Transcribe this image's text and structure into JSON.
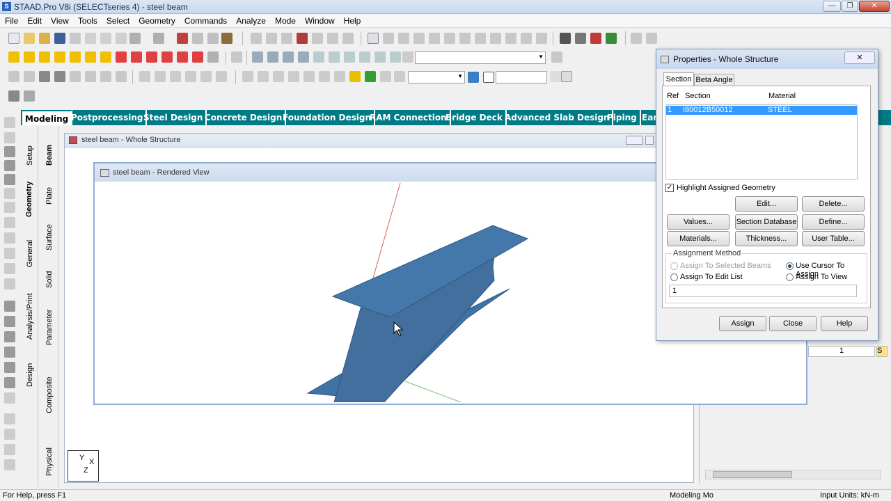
{
  "app": {
    "title": "STAAD.Pro V8i (SELECTseries 4) - steel beam",
    "icon_glyph": "S",
    "win_controls": {
      "minimize": "—",
      "restore": "❐",
      "close": "✕"
    }
  },
  "menu": [
    "File",
    "Edit",
    "View",
    "Tools",
    "Select",
    "Geometry",
    "Commands",
    "Analyze",
    "Mode",
    "Window",
    "Help"
  ],
  "page_tabs": [
    "Modeling",
    "Postprocessing",
    "Steel Design",
    "Concrete Design",
    "Foundation Design",
    "RAM Connection",
    "Bridge Deck",
    "Advanced Slab Design",
    "Piping",
    "Ear"
  ],
  "vertical_tabs_outer": [
    "Setup",
    "Geometry",
    "General",
    "Analysis/Print",
    "Design"
  ],
  "vertical_tabs_inner": [
    "Beam",
    "Plate",
    "Surface",
    "Solid",
    "Parameter",
    "Composite",
    "Physical"
  ],
  "windows": {
    "whole_structure": {
      "title": "steel beam - Whole Structure"
    },
    "rendered_view": {
      "title": "steel beam - Rendered View"
    }
  },
  "axes_triad": {
    "y": "Y",
    "x": "X",
    "z": "Z"
  },
  "properties": {
    "title": "Properties - Whole Structure",
    "tabs": [
      "Section",
      "Beta Angle"
    ],
    "table_headers": {
      "ref": "Ref",
      "section": "Section",
      "material": "Material"
    },
    "rows": [
      {
        "ref": "1",
        "section": "I80012B50012",
        "material": "STEEL"
      }
    ],
    "highlight_label": "Highlight Assigned Geometry",
    "buttons": {
      "edit": "Edit...",
      "delete": "Delete...",
      "values": "Values...",
      "section_db": "Section Database",
      "define": "Define...",
      "materials": "Materials...",
      "thickness": "Thickness...",
      "user_table": "User Table...",
      "assign": "Assign",
      "close": "Close",
      "help": "Help"
    },
    "assignment_method": {
      "legend": "Assignment Method",
      "opt1": "Assign To Selected Beams",
      "opt2": "Use Cursor To Assign",
      "opt3": "Assign To Edit List",
      "opt4": "Assign To View",
      "selected": "Use Cursor To Assign",
      "edit_list_value": "1"
    }
  },
  "right_panel": {
    "cell_value": "1",
    "cell_s": "S"
  },
  "status": {
    "help": "For Help, press F1",
    "mode": "Modeling Mo",
    "units": "Input Units:  kN-m"
  },
  "colors": {
    "accent_teal": "#007b86",
    "beam_blue": "#3f73a6",
    "selection_blue": "#3399ff"
  }
}
